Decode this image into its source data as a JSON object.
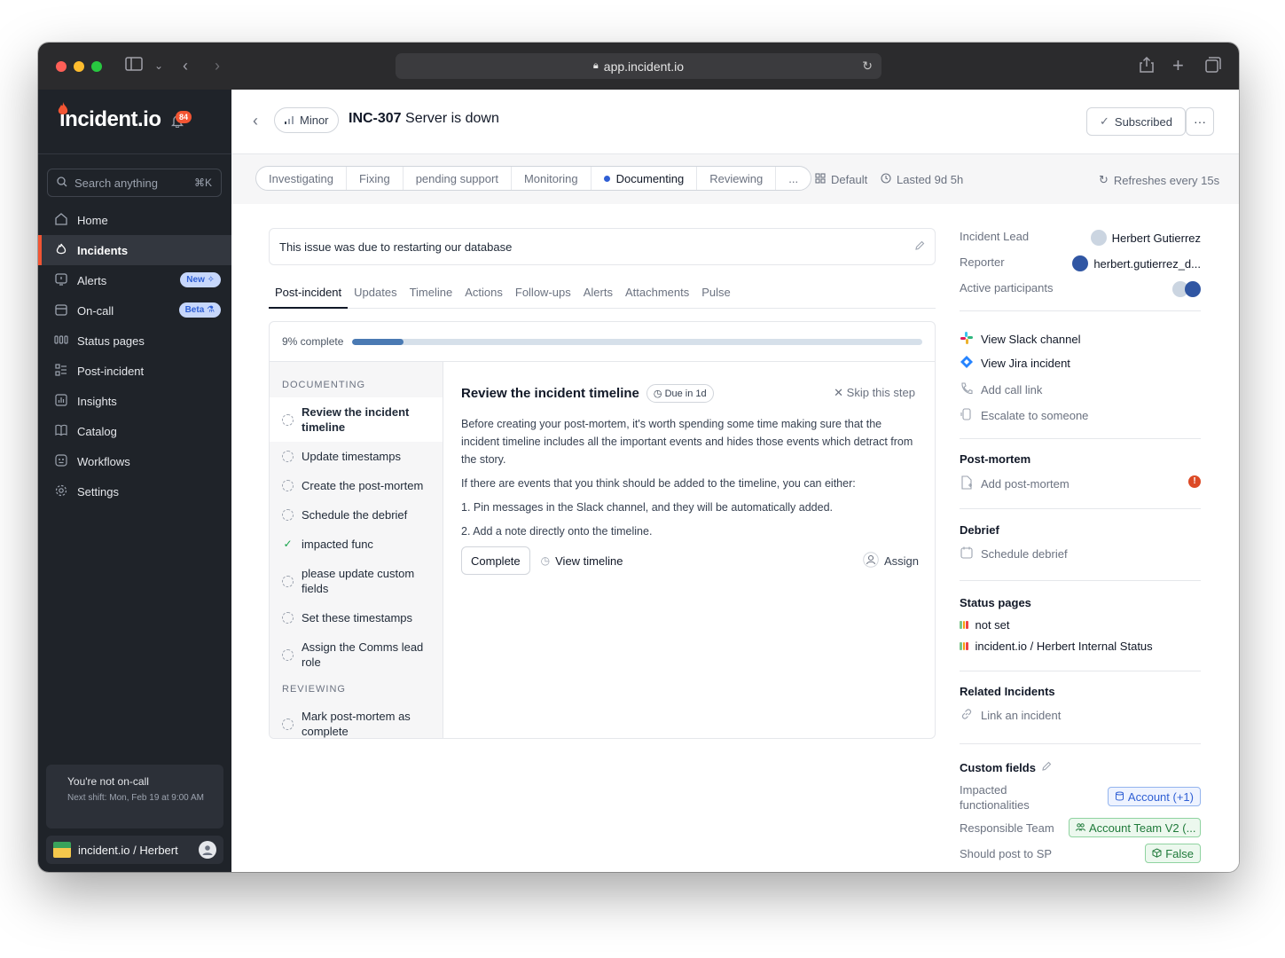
{
  "browser": {
    "url": "app.incident.io"
  },
  "sidebar": {
    "logo": "incident.io",
    "notifications_count": "84",
    "search_placeholder": "Search anything",
    "search_shortcut": "⌘K",
    "items": [
      {
        "label": "Home",
        "icon": "home-icon",
        "active": false
      },
      {
        "label": "Incidents",
        "icon": "flame-icon",
        "active": true
      },
      {
        "label": "Alerts",
        "icon": "alert-icon",
        "badge": "New ✧"
      },
      {
        "label": "On-call",
        "icon": "oncall-icon",
        "badge": "Beta ⚗"
      },
      {
        "label": "Status pages",
        "icon": "status-pages-icon"
      },
      {
        "label": "Post-incident",
        "icon": "post-incident-icon"
      },
      {
        "label": "Insights",
        "icon": "insights-icon"
      },
      {
        "label": "Catalog",
        "icon": "catalog-icon"
      },
      {
        "label": "Workflows",
        "icon": "workflows-icon"
      },
      {
        "label": "Settings",
        "icon": "gear-icon"
      }
    ],
    "oncall": {
      "title": "You're not on-call",
      "next_shift": "Next shift: Mon, Feb 19 at 9:00 AM"
    },
    "org": {
      "name": "incident.io / Herbert"
    }
  },
  "header": {
    "severity": "Minor",
    "incident_id": "INC-307",
    "incident_name": "Server is down",
    "subscribed_label": "Subscribed",
    "more_label": "···"
  },
  "status": {
    "stages": [
      "Investigating",
      "Fixing",
      "pending support",
      "Monitoring",
      "Documenting",
      "Reviewing",
      "..."
    ],
    "current_stage": "Documenting",
    "view": "Default",
    "duration": "Lasted 9d 5h",
    "refresh": "Refreshes every 15s"
  },
  "summary": {
    "text": "This issue was due to restarting our database"
  },
  "tabs": [
    "Post-incident",
    "Updates",
    "Timeline",
    "Actions",
    "Follow-ups",
    "Alerts",
    "Attachments",
    "Pulse"
  ],
  "post_incident": {
    "progress_label": "9% complete",
    "progress_fraction": 0.09,
    "groups": [
      {
        "name": "DOCUMENTING",
        "steps": [
          {
            "label": "Review the incident timeline",
            "state": "active"
          },
          {
            "label": "Update timestamps",
            "state": "todo"
          },
          {
            "label": "Create the post-mortem",
            "state": "todo"
          },
          {
            "label": "Schedule the debrief",
            "state": "todo"
          },
          {
            "label": "impacted func",
            "state": "done"
          },
          {
            "label": "please update custom fields",
            "state": "todo"
          },
          {
            "label": "Set these timestamps",
            "state": "todo"
          },
          {
            "label": "Assign the Comms lead role",
            "state": "todo"
          }
        ]
      },
      {
        "name": "REVIEWING",
        "steps": [
          {
            "label": "Mark post-mortem as complete",
            "state": "todo"
          }
        ]
      }
    ],
    "detail": {
      "title": "Review the incident timeline",
      "due": "Due in 1d",
      "skip": "Skip this step",
      "paragraphs": [
        "Before creating your post-mortem, it's worth spending some time making sure that the incident timeline includes all the important events and hides those events which detract from the story.",
        "If there are events that you think should be added to the timeline, you can either:",
        "1. Pin messages in the Slack channel, and they will be automatically added.",
        "2. Add a note directly onto the timeline."
      ],
      "complete_label": "Complete",
      "view_timeline_label": "View timeline",
      "assign_label": "Assign"
    }
  },
  "right_panel": {
    "lead_label": "Incident Lead",
    "lead_value": "Herbert Gutierrez",
    "reporter_label": "Reporter",
    "reporter_value": "herbert.gutierrez_d...",
    "participants_label": "Active participants",
    "links": {
      "slack": "View Slack channel",
      "jira": "View Jira incident",
      "call": "Add call link",
      "escalate": "Escalate to someone"
    },
    "postmortem": {
      "heading": "Post-mortem",
      "action": "Add post-mortem"
    },
    "debrief": {
      "heading": "Debrief",
      "action": "Schedule debrief"
    },
    "status_pages": {
      "heading": "Status pages",
      "items": [
        "not set",
        "incident.io / Herbert Internal Status"
      ]
    },
    "related": {
      "heading": "Related Incidents",
      "action": "Link an incident"
    },
    "custom_fields": {
      "heading": "Custom fields",
      "rows": [
        {
          "label": "Impacted functionalities",
          "value": "Account (+1)"
        },
        {
          "label": "Responsible Team",
          "value": "Account Team V2 (..."
        },
        {
          "label": "Should post to SP",
          "value": "False"
        }
      ]
    }
  },
  "colors": {
    "accent": "#f25533",
    "sidebar_bg": "#1f2329",
    "progress": "#4a7ab3",
    "link_blue": "#2f5fd4"
  }
}
